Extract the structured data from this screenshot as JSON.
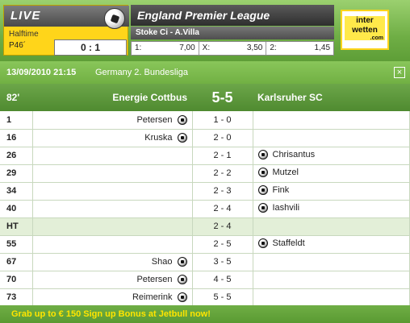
{
  "banner": {
    "live_label": "LIVE",
    "halftime_label": "Halftime",
    "minute": "P46´",
    "mini_score": "0 : 1",
    "league_title": "England Premier League",
    "match_title": "Stoke Ci - A.Villa",
    "odds": [
      {
        "label": "1:",
        "value": "7,00"
      },
      {
        "label": "X:",
        "value": "3,50"
      },
      {
        "label": "2:",
        "value": "1,45"
      }
    ],
    "brand_line1": "inter",
    "brand_line2": "wetten",
    "brand_line3": ".com"
  },
  "panel": {
    "datetime": "13/09/2010 21:15",
    "league": "Germany 2. Bundesliga",
    "close_glyph": "×",
    "minute": "82'",
    "home_team": "Energie Cottbus",
    "score": "5-5",
    "away_team": "Karlsruher SC",
    "events": [
      {
        "min": "1",
        "home": "Petersen",
        "score": "1 - 0",
        "away": ""
      },
      {
        "min": "16",
        "home": "Kruska",
        "score": "2 - 0",
        "away": ""
      },
      {
        "min": "26",
        "home": "",
        "score": "2 - 1",
        "away": "Chrisantus"
      },
      {
        "min": "29",
        "home": "",
        "score": "2 - 2",
        "away": "Mutzel"
      },
      {
        "min": "34",
        "home": "",
        "score": "2 - 3",
        "away": "Fink"
      },
      {
        "min": "40",
        "home": "",
        "score": "2 - 4",
        "away": "Iashvili"
      },
      {
        "min": "HT",
        "home": "",
        "score": "2 - 4",
        "away": ""
      },
      {
        "min": "55",
        "home": "",
        "score": "2 - 5",
        "away": "Staffeldt"
      },
      {
        "min": "67",
        "home": "Shao",
        "score": "3 - 5",
        "away": ""
      },
      {
        "min": "70",
        "home": "Petersen",
        "score": "4 - 5",
        "away": ""
      },
      {
        "min": "73",
        "home": "Reimerink",
        "score": "5 - 5",
        "away": ""
      }
    ],
    "promo": "Grab up to € 150 Sign up Bonus at Jetbull now!"
  }
}
